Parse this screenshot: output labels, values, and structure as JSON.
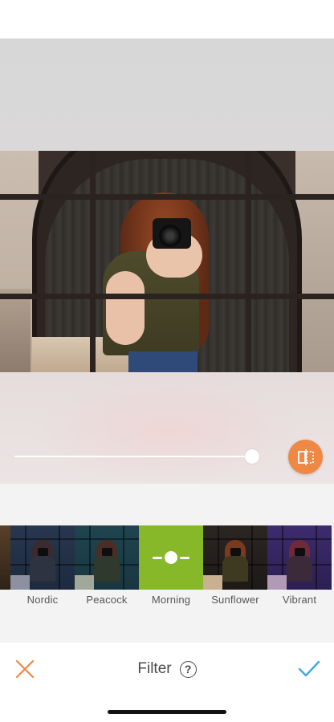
{
  "editor": {
    "intensity_fraction": 1.0
  },
  "toolbar": {
    "title": "Filter",
    "help_glyph": "?",
    "cancel_icon": "close-icon",
    "confirm_icon": "checkmark-icon",
    "compare_icon": "compare-icon"
  },
  "colors": {
    "accent_orange": "#ef8845",
    "confirm_blue": "#3aa9e6",
    "selected_green": "#86b82a"
  },
  "filters": [
    {
      "label": "Nordic",
      "tint": "#2c3d5c",
      "selected": false
    },
    {
      "label": "Peacock",
      "tint": "#1f4550",
      "selected": false
    },
    {
      "label": "Morning",
      "tint": "#86b82a",
      "selected": true
    },
    {
      "label": "Sunflower",
      "tint": "#2a2420",
      "selected": false
    },
    {
      "label": "Vibrant",
      "tint": "#3b2a6b",
      "selected": false
    }
  ]
}
